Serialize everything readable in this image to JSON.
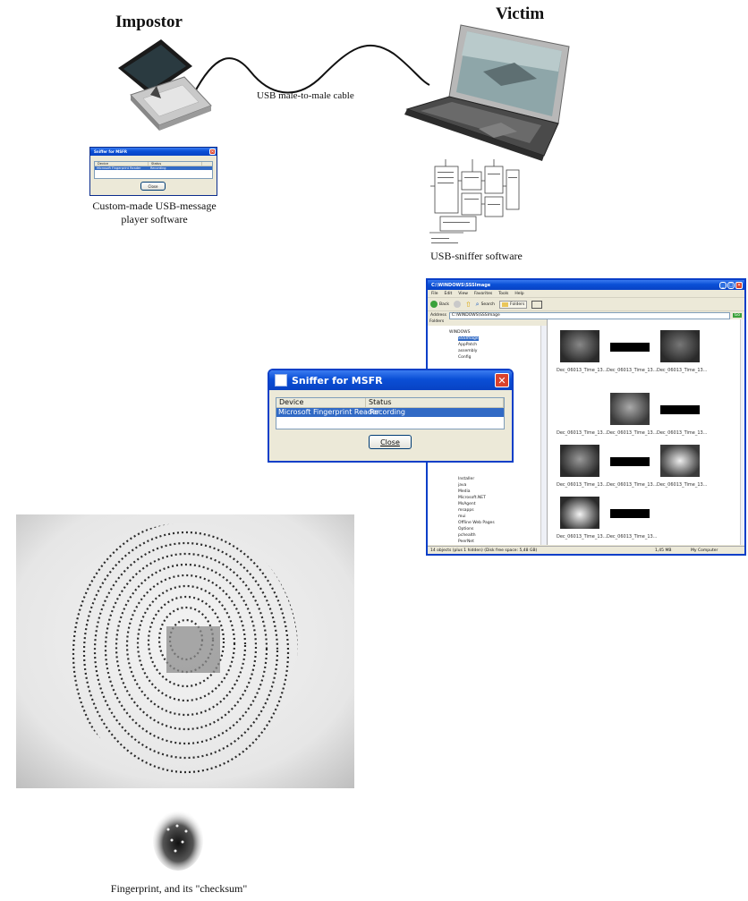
{
  "titles": {
    "impostor": "Impostor",
    "victim": "Victim"
  },
  "cable_label": "USB male-to-male cable",
  "captions": {
    "player": [
      "Custom-made USB-message",
      "player software"
    ],
    "sniffer": "USB-sniffer software",
    "fingerprint": "Fingerprint, and its \"checksum\""
  },
  "sniffer_dialog": {
    "title": "Sniffer for MSFR",
    "columns": [
      "Device",
      "Status"
    ],
    "row": {
      "device": "Microsoft Fingerprint Reader",
      "status": "Recording"
    },
    "close_label": "Close"
  },
  "explorer": {
    "title": "C:\\WINDOWS\\SSSImage",
    "menu": [
      "File",
      "Edit",
      "View",
      "Favorites",
      "Tools",
      "Help"
    ],
    "toolbar": {
      "back": "Back",
      "search": "Search",
      "folders": "Folders"
    },
    "address_label": "Address",
    "address_value": "C:\\WINDOWS\\SSSImage",
    "go_label": "Go",
    "folders_label": "Folders",
    "tree_top": [
      "WINDOWS",
      "SSSImage",
      "AppPatch",
      "assembly",
      "Config"
    ],
    "tree_bottom": [
      "Installer",
      "java",
      "Media",
      "Microsoft.NET",
      "MsAgent",
      "msapps",
      "mui",
      "Offline Web Pages",
      "Options",
      "pchealth",
      "PeerNet"
    ],
    "thumb_caption": "Dec_06013_Time_13...",
    "status_left": "14 objects (plus 1 hidden) (Disk free space: 5,48 GB)",
    "status_size": "1,45 MB",
    "status_right": "My Computer"
  },
  "colors": {
    "xp_blue": "#0a4fd6",
    "xp_select": "#316ac5",
    "xp_face": "#ece9d8",
    "close_red": "#d9422c"
  }
}
